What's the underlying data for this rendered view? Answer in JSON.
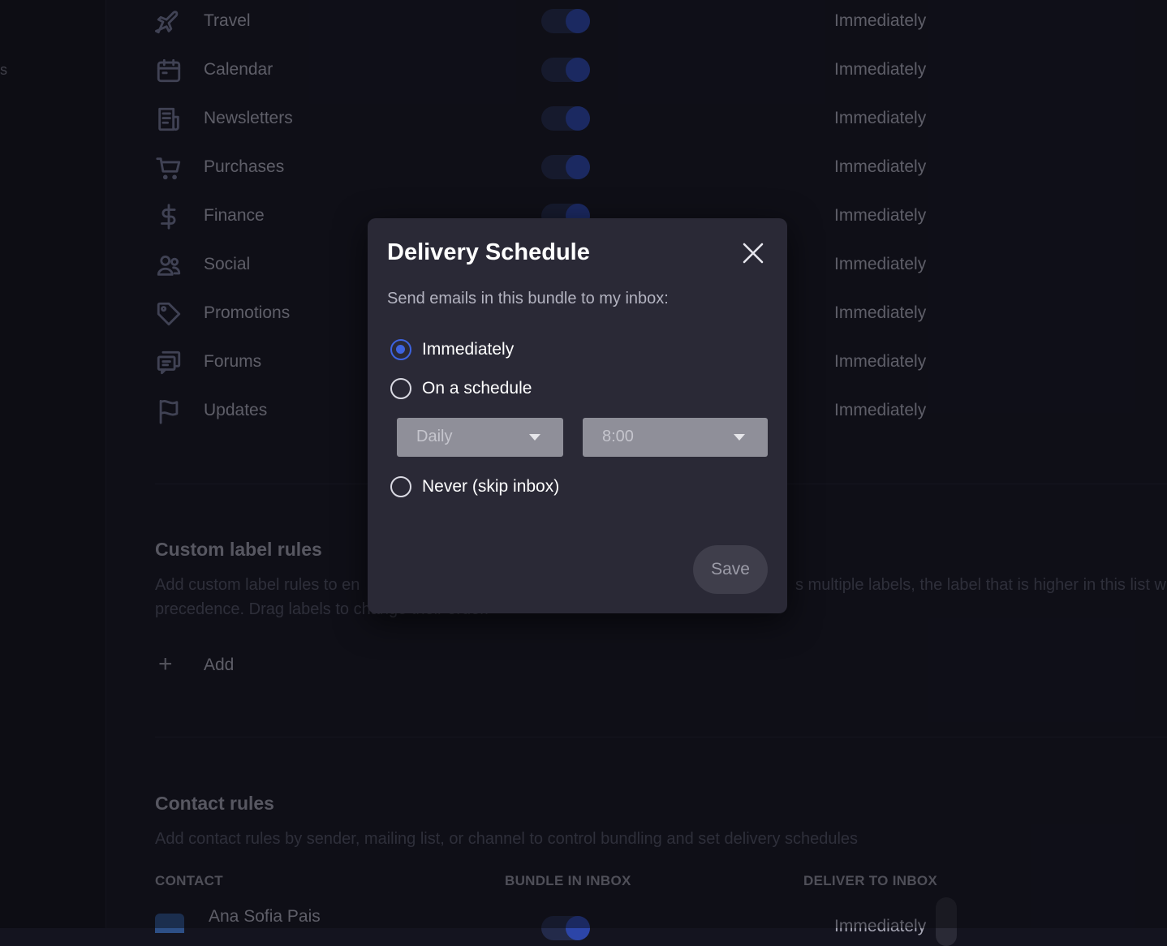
{
  "sidebar": {
    "partial_label": "s"
  },
  "bundles": [
    {
      "icon": "airplane-icon",
      "label": "Travel",
      "enabled": true,
      "deliver": "Immediately"
    },
    {
      "icon": "calendar-icon",
      "label": "Calendar",
      "enabled": true,
      "deliver": "Immediately"
    },
    {
      "icon": "newsletter-icon",
      "label": "Newsletters",
      "enabled": true,
      "deliver": "Immediately"
    },
    {
      "icon": "cart-icon",
      "label": "Purchases",
      "enabled": true,
      "deliver": "Immediately"
    },
    {
      "icon": "dollar-icon",
      "label": "Finance",
      "enabled": true,
      "deliver": "Immediately"
    },
    {
      "icon": "people-icon",
      "label": "Social",
      "enabled": true,
      "deliver": "Immediately"
    },
    {
      "icon": "tag-icon",
      "label": "Promotions",
      "enabled": true,
      "deliver": "Immediately"
    },
    {
      "icon": "chat-icon",
      "label": "Forums",
      "enabled": true,
      "deliver": "Immediately"
    },
    {
      "icon": "flag-icon",
      "label": "Updates",
      "enabled": true,
      "deliver": "Immediately"
    }
  ],
  "custom_label_rules": {
    "title": "Custom label rules",
    "desc_left": "Add custom label rules to en",
    "desc_right": "s multiple labels, the label that is higher in this list w",
    "desc_line2": "precedence. Drag labels to change their order.",
    "add_label": "Add",
    "add_icon": "plus-icon"
  },
  "contact_rules": {
    "title": "Contact rules",
    "desc": "Add contact rules by sender, mailing list, or channel to control bundling and set delivery schedules",
    "columns": [
      "CONTACT",
      "BUNDLE IN INBOX",
      "DELIVER TO INBOX"
    ],
    "rows": [
      {
        "name": "Ana Sofia Pais",
        "bundled": true,
        "deliver": "Immediately"
      }
    ]
  },
  "modal": {
    "title": "Delivery Schedule",
    "subtitle": "Send emails in this bundle to my inbox:",
    "options": [
      {
        "label": "Immediately",
        "checked": true
      },
      {
        "label": "On a schedule",
        "checked": false
      },
      {
        "label": "Never (skip inbox)",
        "checked": false
      }
    ],
    "frequency": {
      "selected": "Daily"
    },
    "time": {
      "selected": "8:00"
    },
    "save_label": "Save",
    "close_icon": "close-icon"
  },
  "colors": {
    "accent": "#3d63e0",
    "toggle_on_knob": "#2c45a8",
    "background": "#161621",
    "modal": "#2a2936"
  }
}
